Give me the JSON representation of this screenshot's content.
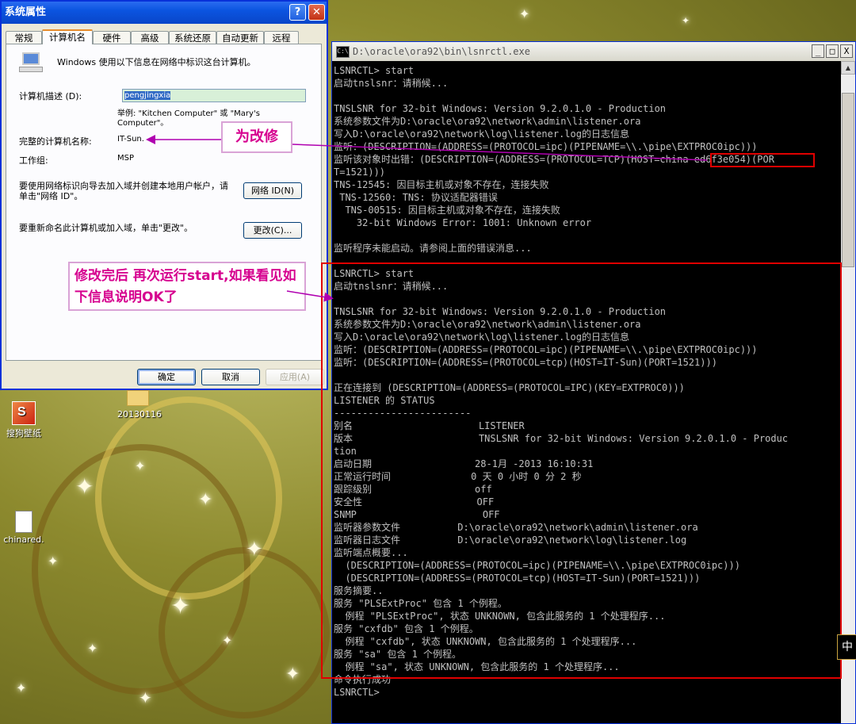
{
  "dialog": {
    "title": "系统属性",
    "help_btn": "?",
    "close_btn": "✕",
    "tabs": [
      "常规",
      "计算机名",
      "硬件",
      "高级",
      "系统还原",
      "自动更新",
      "远程"
    ],
    "intro": "Windows 使用以下信息在网络中标识这台计算机。",
    "desc_label": "计算机描述 (D):",
    "desc_value": "pengjingxia",
    "example": "举例: \"Kitchen Computer\" 或 \"Mary's Computer\"。",
    "fullname_label": "完整的计算机名称:",
    "fullname_value": "IT-Sun.",
    "workgroup_label": "工作组:",
    "workgroup_value": "MSP",
    "wizard_text": "要使用网络标识向导去加入域并创建本地用户帐户，请单击\"网络 ID\"。",
    "network_id_btn": "网络 ID(N)",
    "rename_text": "要重新命名此计算机或加入域，单击\"更改\"。",
    "change_btn": "更改(C)...",
    "ok_btn": "确定",
    "cancel_btn": "取消",
    "apply_btn": "应用(A)"
  },
  "console": {
    "title": "D:\\oracle\\ora92\\bin\\lsnrctl.exe",
    "min_btn": "_",
    "max_btn": "□",
    "close_btn": "X",
    "lines": [
      "LSNRCTL> start",
      "启动tnslsnr：请稍候...",
      "",
      "TNSLSNR for 32-bit Windows: Version 9.2.0.1.0 - Production",
      "系统参数文件为D:\\oracle\\ora92\\network\\admin\\listener.ora",
      "写入D:\\oracle\\ora92\\network\\log\\listener.log的日志信息",
      "监听：(DESCRIPTION=(ADDRESS=(PROTOCOL=ipc)(PIPENAME=\\\\.\\pipe\\EXTPROC0ipc)))",
      "监听该对象时出错：(DESCRIPTION=(ADDRESS=(PROTOCOL=TCP)(HOST=china-ed6f3e054)(POR",
      "T=1521)))",
      "TNS-12545: 因目标主机或对象不存在，连接失败",
      " TNS-12560: TNS: 协议适配器错误",
      "  TNS-00515: 因目标主机或对象不存在，连接失败",
      "    32-bit Windows Error: 1001: Unknown error",
      "",
      "监听程序未能启动。请参阅上面的错误消息...",
      "",
      "LSNRCTL> start",
      "启动tnslsnr：请稍候...",
      "",
      "TNSLSNR for 32-bit Windows: Version 9.2.0.1.0 - Production",
      "系统参数文件为D:\\oracle\\ora92\\network\\admin\\listener.ora",
      "写入D:\\oracle\\ora92\\network\\log\\listener.log的日志信息",
      "监听：(DESCRIPTION=(ADDRESS=(PROTOCOL=ipc)(PIPENAME=\\\\.\\pipe\\EXTPROC0ipc)))",
      "监听：(DESCRIPTION=(ADDRESS=(PROTOCOL=tcp)(HOST=IT-Sun)(PORT=1521)))",
      "",
      "正在连接到 (DESCRIPTION=(ADDRESS=(PROTOCOL=IPC)(KEY=EXTPROC0)))",
      "LISTENER 的 STATUS",
      "------------------------",
      "别名                      LISTENER",
      "版本                      TNSLSNR for 32-bit Windows: Version 9.2.0.1.0 - Produc",
      "tion",
      "启动日期                  28-1月 -2013 16:10:31",
      "正常运行时间              0 天 0 小时 0 分 2 秒",
      "跟踪级别                  off",
      "安全性                    OFF",
      "SNMP                      OFF",
      "监听器参数文件          D:\\oracle\\ora92\\network\\admin\\listener.ora",
      "监听器日志文件          D:\\oracle\\ora92\\network\\log\\listener.log",
      "监听端点概要...",
      "  (DESCRIPTION=(ADDRESS=(PROTOCOL=ipc)(PIPENAME=\\\\.\\pipe\\EXTPROC0ipc)))",
      "  (DESCRIPTION=(ADDRESS=(PROTOCOL=tcp)(HOST=IT-Sun)(PORT=1521)))",
      "服务摘要..",
      "服务 \"PLSExtProc\" 包含 1 个例程。",
      "  例程 \"PLSExtProc\", 状态 UNKNOWN, 包含此服务的 1 个处理程序...",
      "服务 \"cxfdb\" 包含 1 个例程。",
      "  例程 \"cxfdb\", 状态 UNKNOWN, 包含此服务的 1 个处理程序...",
      "服务 \"sa\" 包含 1 个例程。",
      "  例程 \"sa\", 状态 UNKNOWN, 包含此服务的 1 个处理程序...",
      "命令执行成功",
      "LSNRCTL>"
    ]
  },
  "annotations": {
    "callout_rename": "为改修",
    "callout_rerun": "修改完后  再次运行start,如果看见如下信息说明OK了"
  },
  "desktop": {
    "icon1_label": "搜狗壁纸",
    "icon2_label": "chinared.",
    "folder_label": "20130116",
    "ime_indicator": "中"
  }
}
